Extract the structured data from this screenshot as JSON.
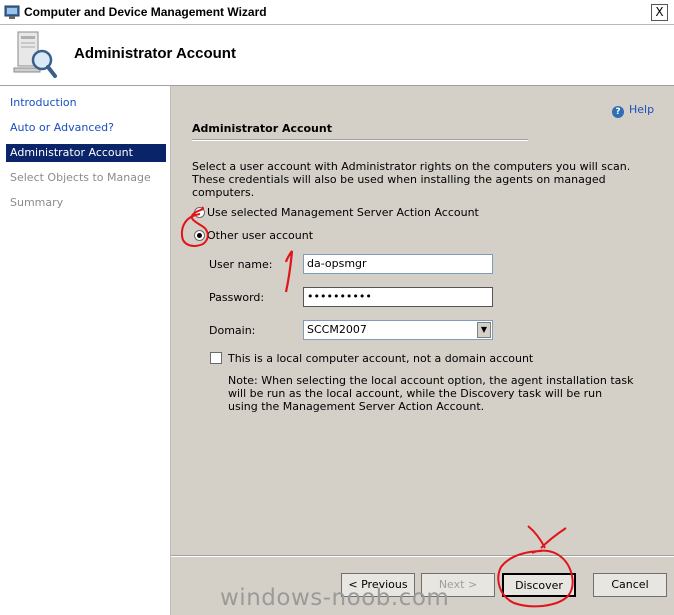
{
  "window": {
    "title": "Computer and Device Management Wizard",
    "close_label": "X"
  },
  "header": {
    "title": "Administrator Account"
  },
  "nav": {
    "items": [
      {
        "label": "Introduction",
        "state": "link"
      },
      {
        "label": "Auto or Advanced?",
        "state": "link"
      },
      {
        "label": "Administrator Account",
        "state": "selected"
      },
      {
        "label": "Select Objects to Manage",
        "state": "disabled"
      },
      {
        "label": "Summary",
        "state": "disabled"
      }
    ]
  },
  "help": {
    "label": "Help",
    "icon": "help-question-icon"
  },
  "section": {
    "title": "Administrator Account",
    "description": "Select a user account with Administrator rights on the computers you will scan. These credentials will also be used when installing the agents on managed computers."
  },
  "options": {
    "use_action_account_label": "Use selected Management Server Action Account",
    "use_action_account_selected": false,
    "other_account_label": "Other user account",
    "other_account_selected": true
  },
  "form": {
    "username_label": "User name:",
    "username_value": "da-opsmgr",
    "password_label": "Password:",
    "password_value": "••••••••••",
    "domain_label": "Domain:",
    "domain_value": "SCCM2007",
    "local_account_label": "This is a local computer account, not a domain account",
    "local_account_checked": false,
    "note": "Note:  When selecting the local account option, the agent installation task will be run as the local account, while the Discovery task will be run using the Management Server Action Account."
  },
  "buttons": {
    "previous": "< Previous",
    "next": "Next >",
    "discover": "Discover",
    "cancel": "Cancel"
  },
  "watermark": "windows-noob.com",
  "colors": {
    "selection": "#0a246a",
    "link": "#1a4fbf",
    "annotation": "#e0141a"
  }
}
